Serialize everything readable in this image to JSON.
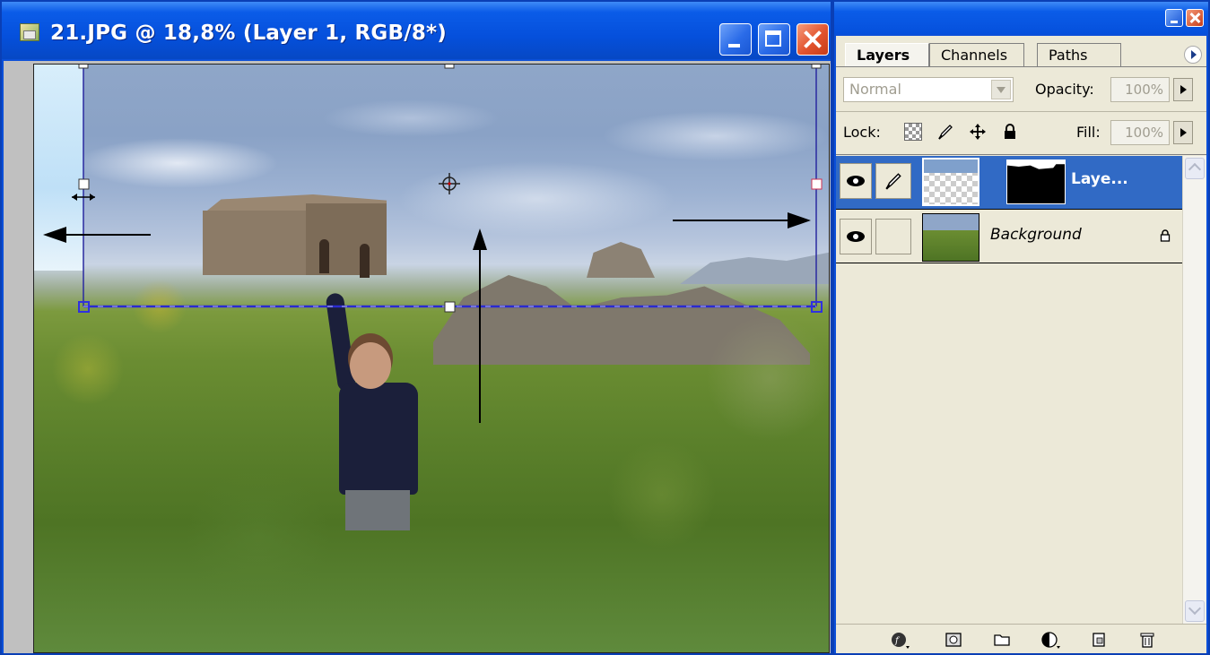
{
  "document": {
    "title": "21.JPG @ 18,8% (Layer 1, RGB/8*)",
    "icon": "photoshop-document-icon",
    "buttons": [
      "minimize-icon",
      "maximize-icon",
      "close-icon"
    ]
  },
  "palette": {
    "tabs": [
      {
        "label": "Layers",
        "active": true
      },
      {
        "label": "Channels",
        "active": false
      },
      {
        "label": "Paths",
        "active": false
      }
    ],
    "blend_mode": "Normal",
    "opacity_label": "Opacity:",
    "opacity_value": "100%",
    "lock_label": "Lock:",
    "lock_icons": [
      "lock-transparent-icon",
      "lock-image-icon",
      "lock-position-icon",
      "lock-all-icon"
    ],
    "fill_label": "Fill:",
    "fill_value": "100%",
    "layers": [
      {
        "name": "Laye...",
        "selected": true,
        "visible": true,
        "has_mask": true
      },
      {
        "name": "Background",
        "selected": false,
        "visible": true,
        "locked": true
      }
    ],
    "bottom_icons": [
      "layer-style-icon",
      "layer-mask-icon",
      "new-group-icon",
      "adjustment-layer-icon",
      "new-layer-icon",
      "trash-icon"
    ]
  },
  "colors": {
    "titlebar": "#0550dc",
    "selection": "#316ac5",
    "panel": "#ece9d8"
  }
}
